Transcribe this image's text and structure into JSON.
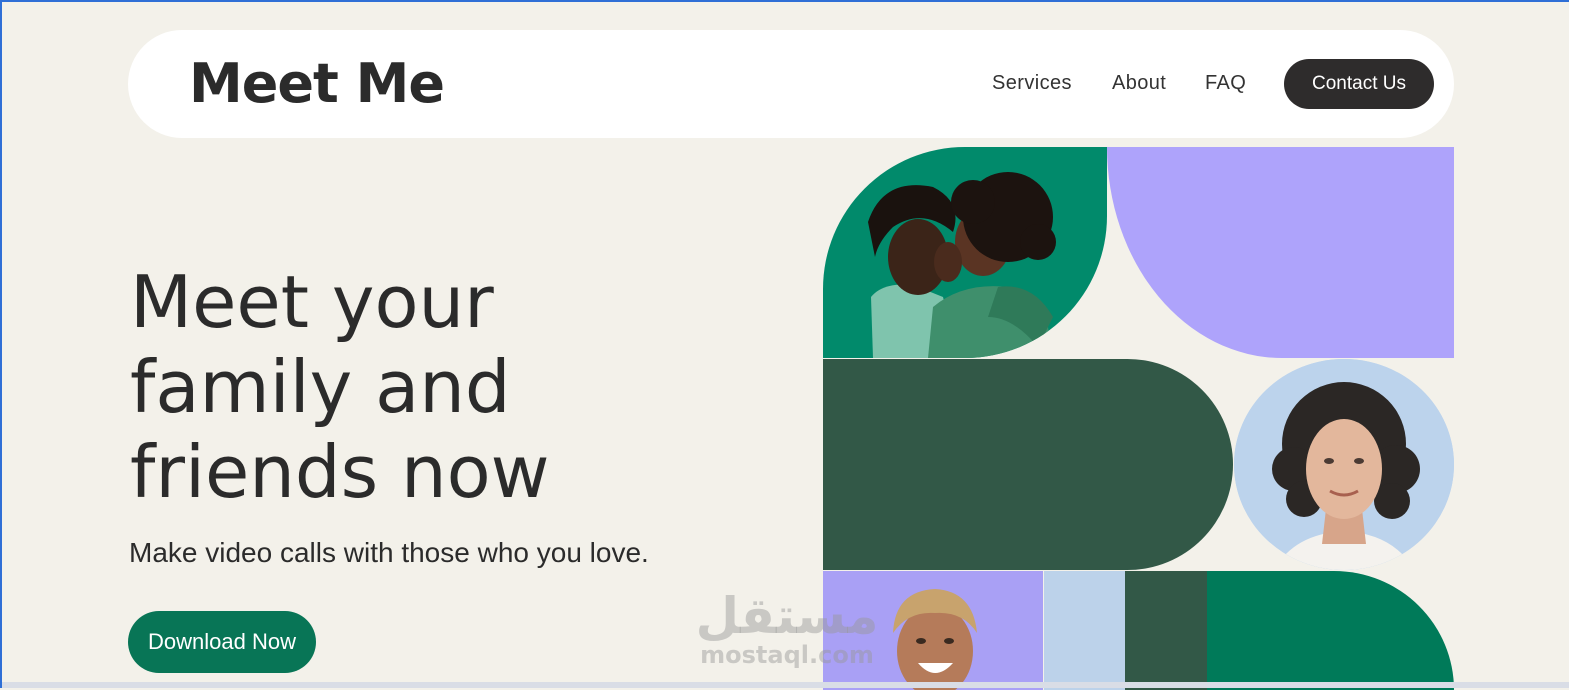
{
  "header": {
    "logo": "Meet Me",
    "nav": {
      "services": "Services",
      "about": "About",
      "faq": "FAQ"
    },
    "contact_label": "Contact Us"
  },
  "hero": {
    "title_lines": [
      "Meet your",
      "family and",
      "friends now"
    ],
    "subtitle": "Make video calls with those who you love.",
    "cta_label": "Download Now"
  },
  "watermark": {
    "arabic": "مستقل",
    "latin": "mostaql.com"
  },
  "colors": {
    "page_bg": "#f3f1ea",
    "accent_green": "#087556",
    "dark_green": "#325847",
    "lavender": "#aea3fb",
    "light_blue": "#bcd3ec",
    "dark_button": "#2e2c2c"
  },
  "images": {
    "mother_child": "mother-kissing-child-photo",
    "woman_portrait": "smiling-woman-curly-hair-photo",
    "man_portrait": "laughing-man-blond-hair-photo"
  }
}
